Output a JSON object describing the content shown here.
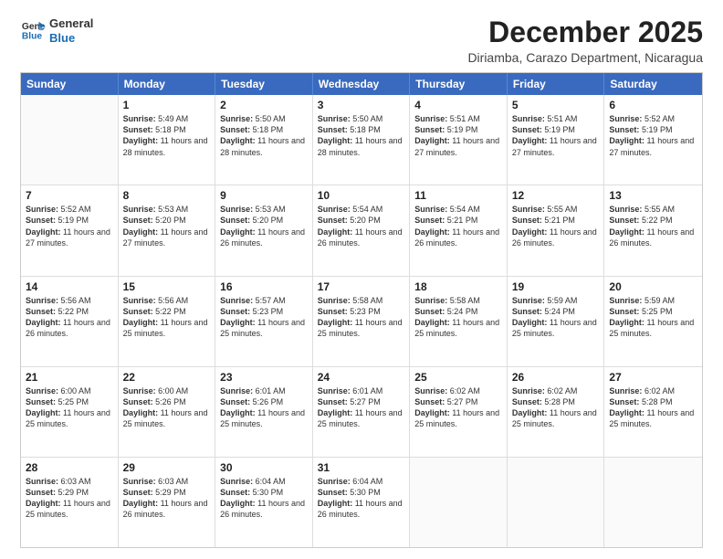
{
  "logo": {
    "line1": "General",
    "line2": "Blue"
  },
  "title": "December 2025",
  "subtitle": "Diriamba, Carazo Department, Nicaragua",
  "header": {
    "days": [
      "Sunday",
      "Monday",
      "Tuesday",
      "Wednesday",
      "Thursday",
      "Friday",
      "Saturday"
    ]
  },
  "weeks": [
    [
      {
        "day": "",
        "empty": true
      },
      {
        "day": "1",
        "sunrise": "5:49 AM",
        "sunset": "5:18 PM",
        "daylight": "11 hours and 28 minutes."
      },
      {
        "day": "2",
        "sunrise": "5:50 AM",
        "sunset": "5:18 PM",
        "daylight": "11 hours and 28 minutes."
      },
      {
        "day": "3",
        "sunrise": "5:50 AM",
        "sunset": "5:18 PM",
        "daylight": "11 hours and 28 minutes."
      },
      {
        "day": "4",
        "sunrise": "5:51 AM",
        "sunset": "5:19 PM",
        "daylight": "11 hours and 27 minutes."
      },
      {
        "day": "5",
        "sunrise": "5:51 AM",
        "sunset": "5:19 PM",
        "daylight": "11 hours and 27 minutes."
      },
      {
        "day": "6",
        "sunrise": "5:52 AM",
        "sunset": "5:19 PM",
        "daylight": "11 hours and 27 minutes."
      }
    ],
    [
      {
        "day": "7",
        "sunrise": "5:52 AM",
        "sunset": "5:19 PM",
        "daylight": "11 hours and 27 minutes."
      },
      {
        "day": "8",
        "sunrise": "5:53 AM",
        "sunset": "5:20 PM",
        "daylight": "11 hours and 27 minutes."
      },
      {
        "day": "9",
        "sunrise": "5:53 AM",
        "sunset": "5:20 PM",
        "daylight": "11 hours and 26 minutes."
      },
      {
        "day": "10",
        "sunrise": "5:54 AM",
        "sunset": "5:20 PM",
        "daylight": "11 hours and 26 minutes."
      },
      {
        "day": "11",
        "sunrise": "5:54 AM",
        "sunset": "5:21 PM",
        "daylight": "11 hours and 26 minutes."
      },
      {
        "day": "12",
        "sunrise": "5:55 AM",
        "sunset": "5:21 PM",
        "daylight": "11 hours and 26 minutes."
      },
      {
        "day": "13",
        "sunrise": "5:55 AM",
        "sunset": "5:22 PM",
        "daylight": "11 hours and 26 minutes."
      }
    ],
    [
      {
        "day": "14",
        "sunrise": "5:56 AM",
        "sunset": "5:22 PM",
        "daylight": "11 hours and 26 minutes."
      },
      {
        "day": "15",
        "sunrise": "5:56 AM",
        "sunset": "5:22 PM",
        "daylight": "11 hours and 25 minutes."
      },
      {
        "day": "16",
        "sunrise": "5:57 AM",
        "sunset": "5:23 PM",
        "daylight": "11 hours and 25 minutes."
      },
      {
        "day": "17",
        "sunrise": "5:58 AM",
        "sunset": "5:23 PM",
        "daylight": "11 hours and 25 minutes."
      },
      {
        "day": "18",
        "sunrise": "5:58 AM",
        "sunset": "5:24 PM",
        "daylight": "11 hours and 25 minutes."
      },
      {
        "day": "19",
        "sunrise": "5:59 AM",
        "sunset": "5:24 PM",
        "daylight": "11 hours and 25 minutes."
      },
      {
        "day": "20",
        "sunrise": "5:59 AM",
        "sunset": "5:25 PM",
        "daylight": "11 hours and 25 minutes."
      }
    ],
    [
      {
        "day": "21",
        "sunrise": "6:00 AM",
        "sunset": "5:25 PM",
        "daylight": "11 hours and 25 minutes."
      },
      {
        "day": "22",
        "sunrise": "6:00 AM",
        "sunset": "5:26 PM",
        "daylight": "11 hours and 25 minutes."
      },
      {
        "day": "23",
        "sunrise": "6:01 AM",
        "sunset": "5:26 PM",
        "daylight": "11 hours and 25 minutes."
      },
      {
        "day": "24",
        "sunrise": "6:01 AM",
        "sunset": "5:27 PM",
        "daylight": "11 hours and 25 minutes."
      },
      {
        "day": "25",
        "sunrise": "6:02 AM",
        "sunset": "5:27 PM",
        "daylight": "11 hours and 25 minutes."
      },
      {
        "day": "26",
        "sunrise": "6:02 AM",
        "sunset": "5:28 PM",
        "daylight": "11 hours and 25 minutes."
      },
      {
        "day": "27",
        "sunrise": "6:02 AM",
        "sunset": "5:28 PM",
        "daylight": "11 hours and 25 minutes."
      }
    ],
    [
      {
        "day": "28",
        "sunrise": "6:03 AM",
        "sunset": "5:29 PM",
        "daylight": "11 hours and 25 minutes."
      },
      {
        "day": "29",
        "sunrise": "6:03 AM",
        "sunset": "5:29 PM",
        "daylight": "11 hours and 26 minutes."
      },
      {
        "day": "30",
        "sunrise": "6:04 AM",
        "sunset": "5:30 PM",
        "daylight": "11 hours and 26 minutes."
      },
      {
        "day": "31",
        "sunrise": "6:04 AM",
        "sunset": "5:30 PM",
        "daylight": "11 hours and 26 minutes."
      },
      {
        "day": "",
        "empty": true
      },
      {
        "day": "",
        "empty": true
      },
      {
        "day": "",
        "empty": true
      }
    ]
  ]
}
